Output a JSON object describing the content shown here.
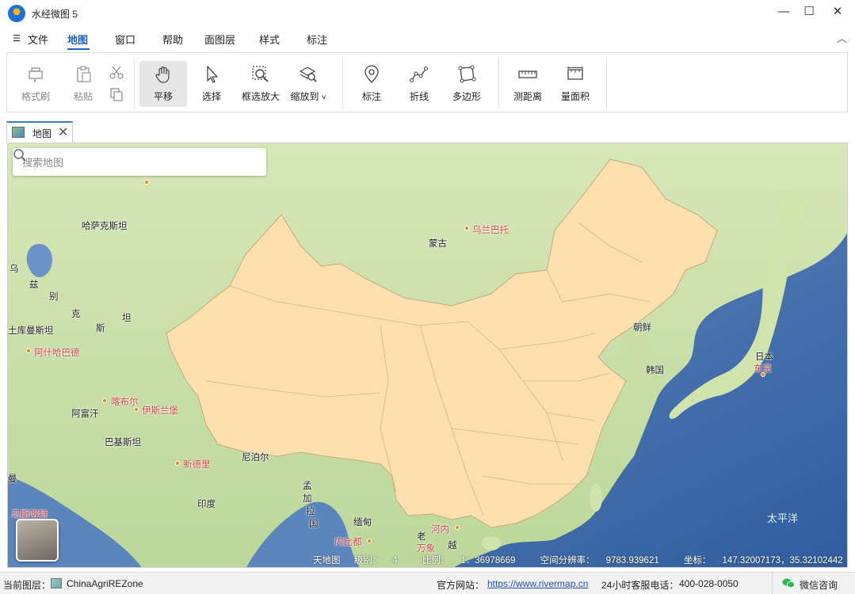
{
  "window": {
    "title": "水经微图 5",
    "controls": {
      "minimize": "—",
      "maximize": "☐",
      "close": "✕"
    }
  },
  "menu": {
    "items": [
      "文件",
      "地图",
      "窗口",
      "帮助",
      "面图层",
      "样式",
      "标注"
    ],
    "active": "地图"
  },
  "ribbon": {
    "buttons": {
      "format_painter": "格式刷",
      "paste": "粘贴",
      "pan": "平移",
      "select": "选择",
      "box_zoom": "框选放大",
      "zoom_to": "缩放到",
      "mark": "标注",
      "polyline": "折线",
      "polygon": "多边形",
      "measure_distance": "测距离",
      "measure_area": "量面积"
    },
    "selected": "平移",
    "zoom_to_dropdown": "˅"
  },
  "tab": {
    "label": "地图",
    "close": "✕"
  },
  "map": {
    "search_placeholder": "搜索地图",
    "labels": {
      "kazakhstan": "哈萨克斯坦",
      "mongolia": "蒙古",
      "ulaanbaatar": "乌兰巴托",
      "uz1": "乌",
      "uz2": "兹",
      "uz3": "别",
      "uz4": "克",
      "uz5": "斯",
      "uz6": "坦",
      "turkmenistan": "土库曼斯坦",
      "ashgabat": "阿什哈巴德",
      "afghanistan": "阿富汗",
      "kabul": "喀布尔",
      "islamabad": "伊斯兰堡",
      "pakistan": "巴基斯坦",
      "new_delhi": "新德里",
      "nepal": "尼泊尔",
      "india": "印度",
      "bangladesh1": "孟",
      "bangladesh2": "加",
      "bangladesh3": "拉",
      "bangladesh4": "国",
      "myanmar": "缅甸",
      "naypyidaw": "内比都",
      "laos": "老",
      "vientiane": "万象",
      "vietnam1": "越",
      "hanoi": "河内",
      "korea_north": "朝鲜",
      "korea_south": "韩国",
      "japan": "日本",
      "tokyo": "东京",
      "pacific": "太平洋",
      "maldives_edge": "马斯喀特",
      "edge_man": "曼"
    },
    "status": {
      "source": "天地图",
      "level_label": "级别：",
      "level": "4",
      "scale_label": "比例：",
      "scale": "1：36978669",
      "resolution_label": "空间分辨率：",
      "resolution": "9783.939621",
      "coord_label": "坐标：",
      "coord": "147.32007173，35.32102442"
    },
    "colors": {
      "china_fill": "#fde0ae",
      "china_border": "#c8a880",
      "ocean": "#4a75b0",
      "land_green": "#cfe2b0",
      "city": "#d2443f"
    }
  },
  "statusbar": {
    "current_layer_label": "当前图层：",
    "current_layer": "ChinaAgriREZone",
    "site_label": "官方网站：",
    "site_url": "https://www.rivermap.cn",
    "hotline_label": "24小时客服电话：",
    "hotline": "400-028-0050",
    "wechat": "微信咨询"
  }
}
